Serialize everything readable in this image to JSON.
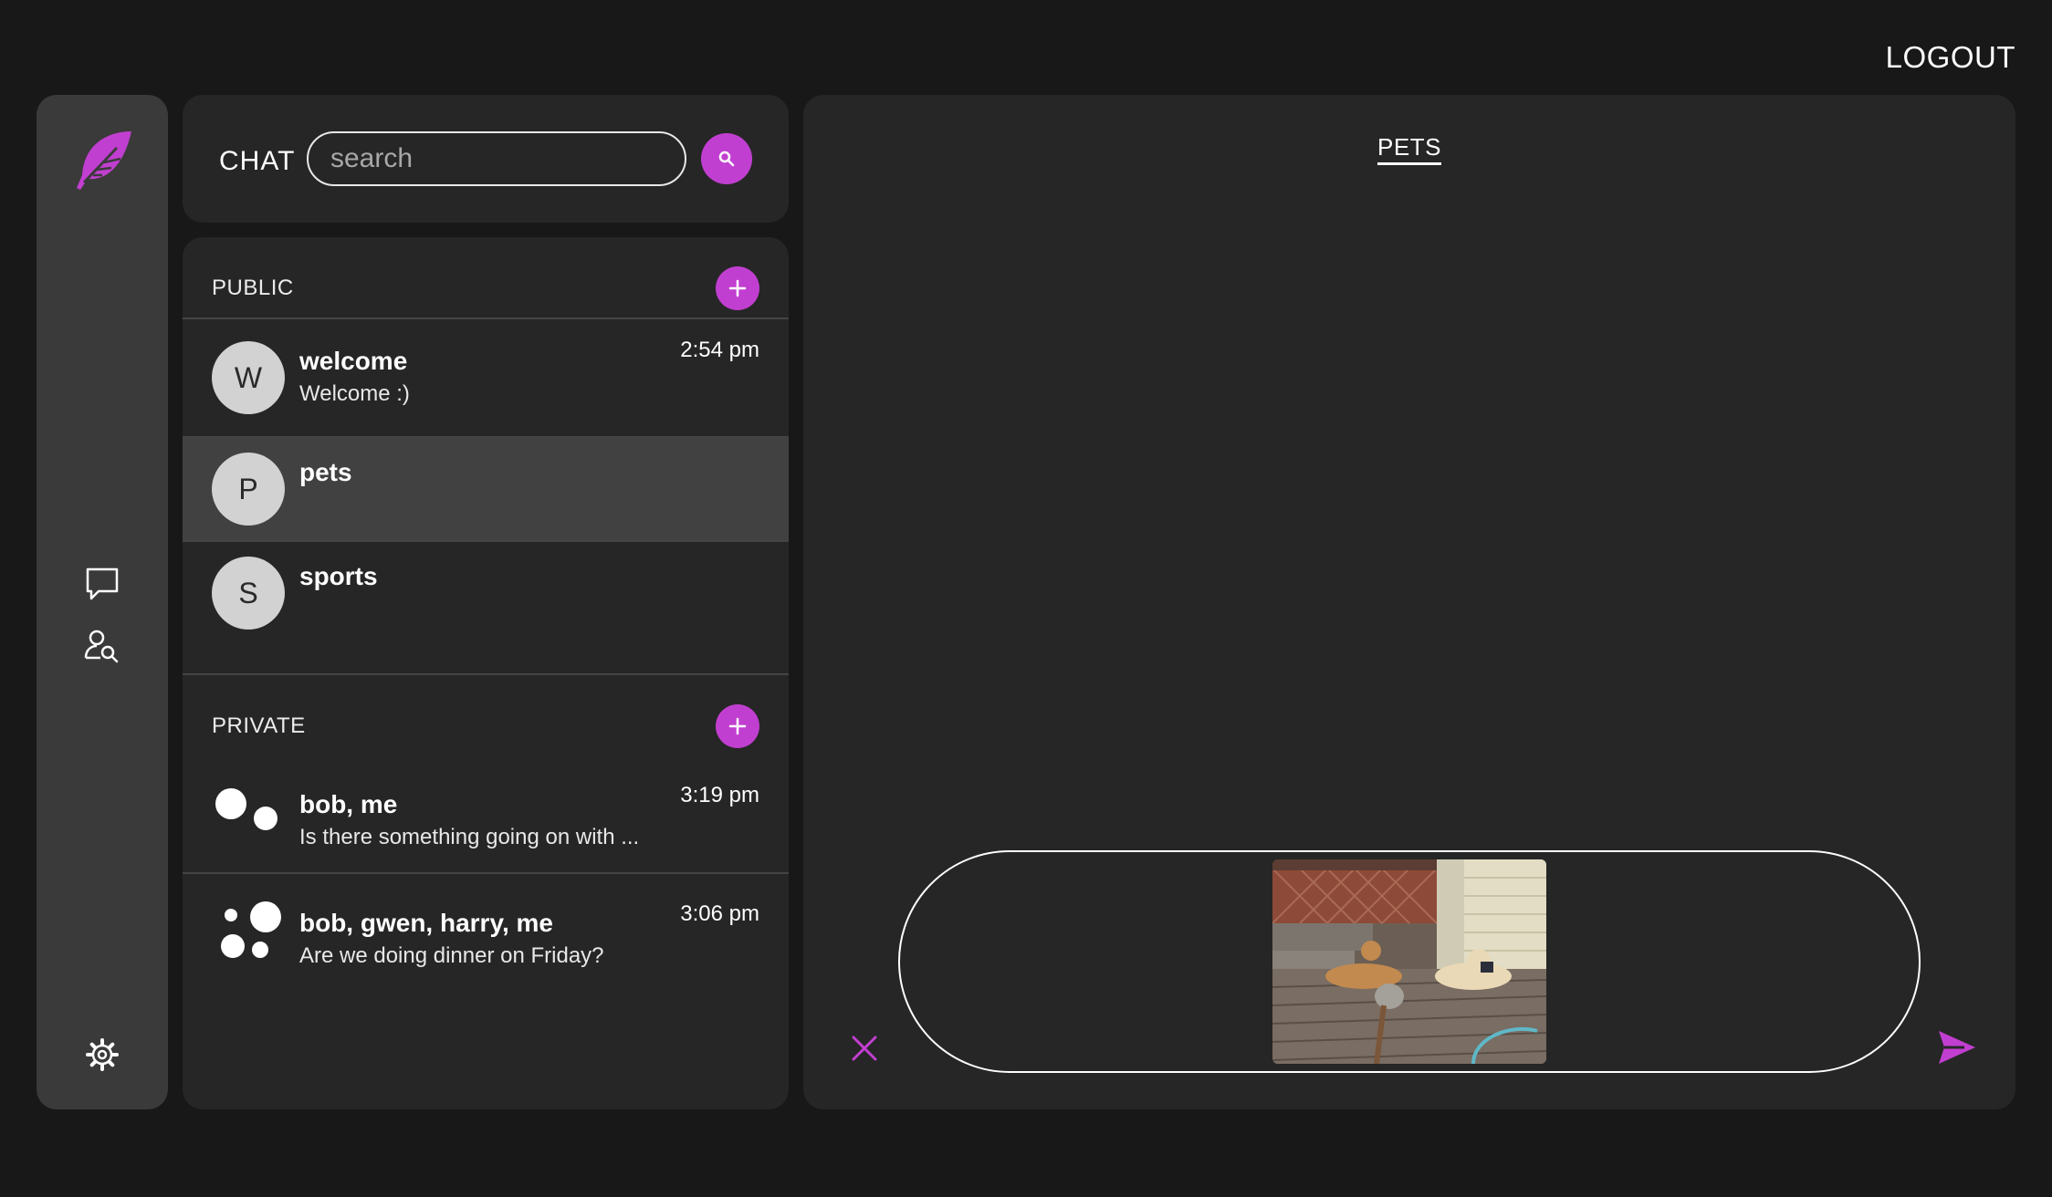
{
  "header": {
    "logout_label": "LOGOUT"
  },
  "rail": {
    "logo_icon": "feather-icon",
    "nav": [
      "chat-bubble-icon",
      "user-search-icon"
    ],
    "settings_icon": "gear-icon"
  },
  "search": {
    "label": "CHAT",
    "placeholder": "search",
    "button_icon": "search-icon"
  },
  "public": {
    "title": "PUBLIC",
    "rooms": [
      {
        "initial": "W",
        "name": "welcome",
        "preview": "Welcome :)",
        "time": "2:54 pm"
      },
      {
        "initial": "P",
        "name": "pets",
        "preview": "",
        "time": ""
      },
      {
        "initial": "S",
        "name": "sports",
        "preview": "",
        "time": ""
      }
    ]
  },
  "private": {
    "title": "PRIVATE",
    "rooms": [
      {
        "name": "bob, me",
        "preview": "Is there something going on with ...",
        "time": "3:19 pm"
      },
      {
        "name": "bob, gwen, harry, me",
        "preview": "Are we doing dinner on Friday?",
        "time": "3:06 pm"
      }
    ]
  },
  "channel": {
    "title": "PETS"
  },
  "composer": {
    "cancel_icon": "close-icon",
    "send_icon": "send-icon",
    "attachment": "dogs-photo"
  },
  "colors": {
    "accent": "#c13fd0",
    "background": "#181818",
    "panel": "#262626",
    "rail": "#3a3a3a",
    "selected": "#414141"
  }
}
